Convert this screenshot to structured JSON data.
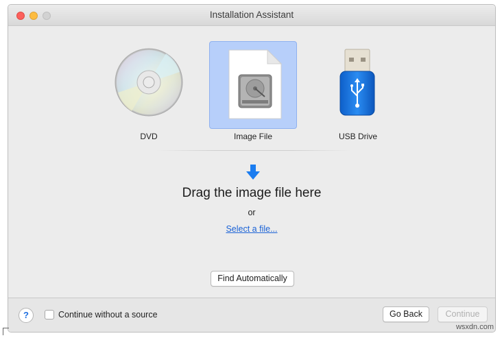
{
  "window": {
    "title": "Installation Assistant"
  },
  "sources": {
    "dvd_label": "DVD",
    "image_label": "Image File",
    "usb_label": "USB Drive",
    "selected": "Image File"
  },
  "drop_area": {
    "heading": "Drag the image file here",
    "or_text": "or",
    "select_link": "Select a file...",
    "arrow_icon": "arrow-down-icon"
  },
  "buttons": {
    "find_automatically": "Find Automatically",
    "go_back": "Go Back",
    "continue": "Continue"
  },
  "footer": {
    "help": "?",
    "checkbox_label": "Continue without a source",
    "checkbox_checked": false
  },
  "watermark": "wsxdn.com",
  "colors": {
    "selection": "#b7cffa",
    "accent": "#1a7cf0",
    "link": "#1a62d6"
  }
}
